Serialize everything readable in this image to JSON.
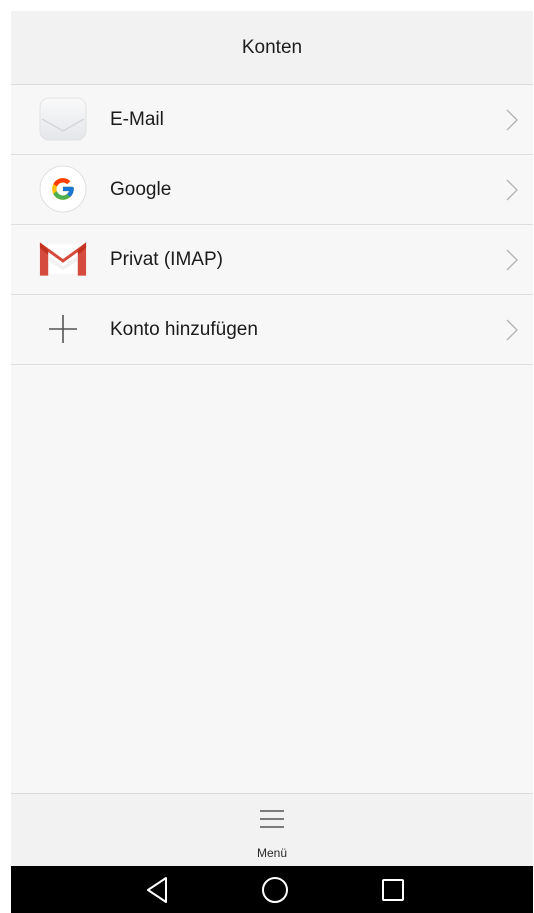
{
  "header": {
    "title": "Konten"
  },
  "accounts": [
    {
      "label": "E-Mail",
      "icon": "email-envelope-icon"
    },
    {
      "label": "Google",
      "icon": "google-g-icon"
    },
    {
      "label": "Privat (IMAP)",
      "icon": "gmail-m-icon"
    },
    {
      "label": "Konto hinzufügen",
      "icon": "plus-icon"
    }
  ],
  "footer": {
    "menu_label": "Menü",
    "menu_icon": "hamburger-menu-icon"
  },
  "navbar": {
    "back_icon": "back-triangle-icon",
    "home_icon": "home-circle-icon",
    "recents_icon": "recents-square-icon"
  },
  "colors": {
    "background": "#f7f7f7",
    "header_bg": "#f2f2f2",
    "divider": "#dedede",
    "text": "#1b1b1b",
    "chevron": "#b5b5b5",
    "gmail_red": "#d54b3d",
    "navbar": "#000000"
  }
}
